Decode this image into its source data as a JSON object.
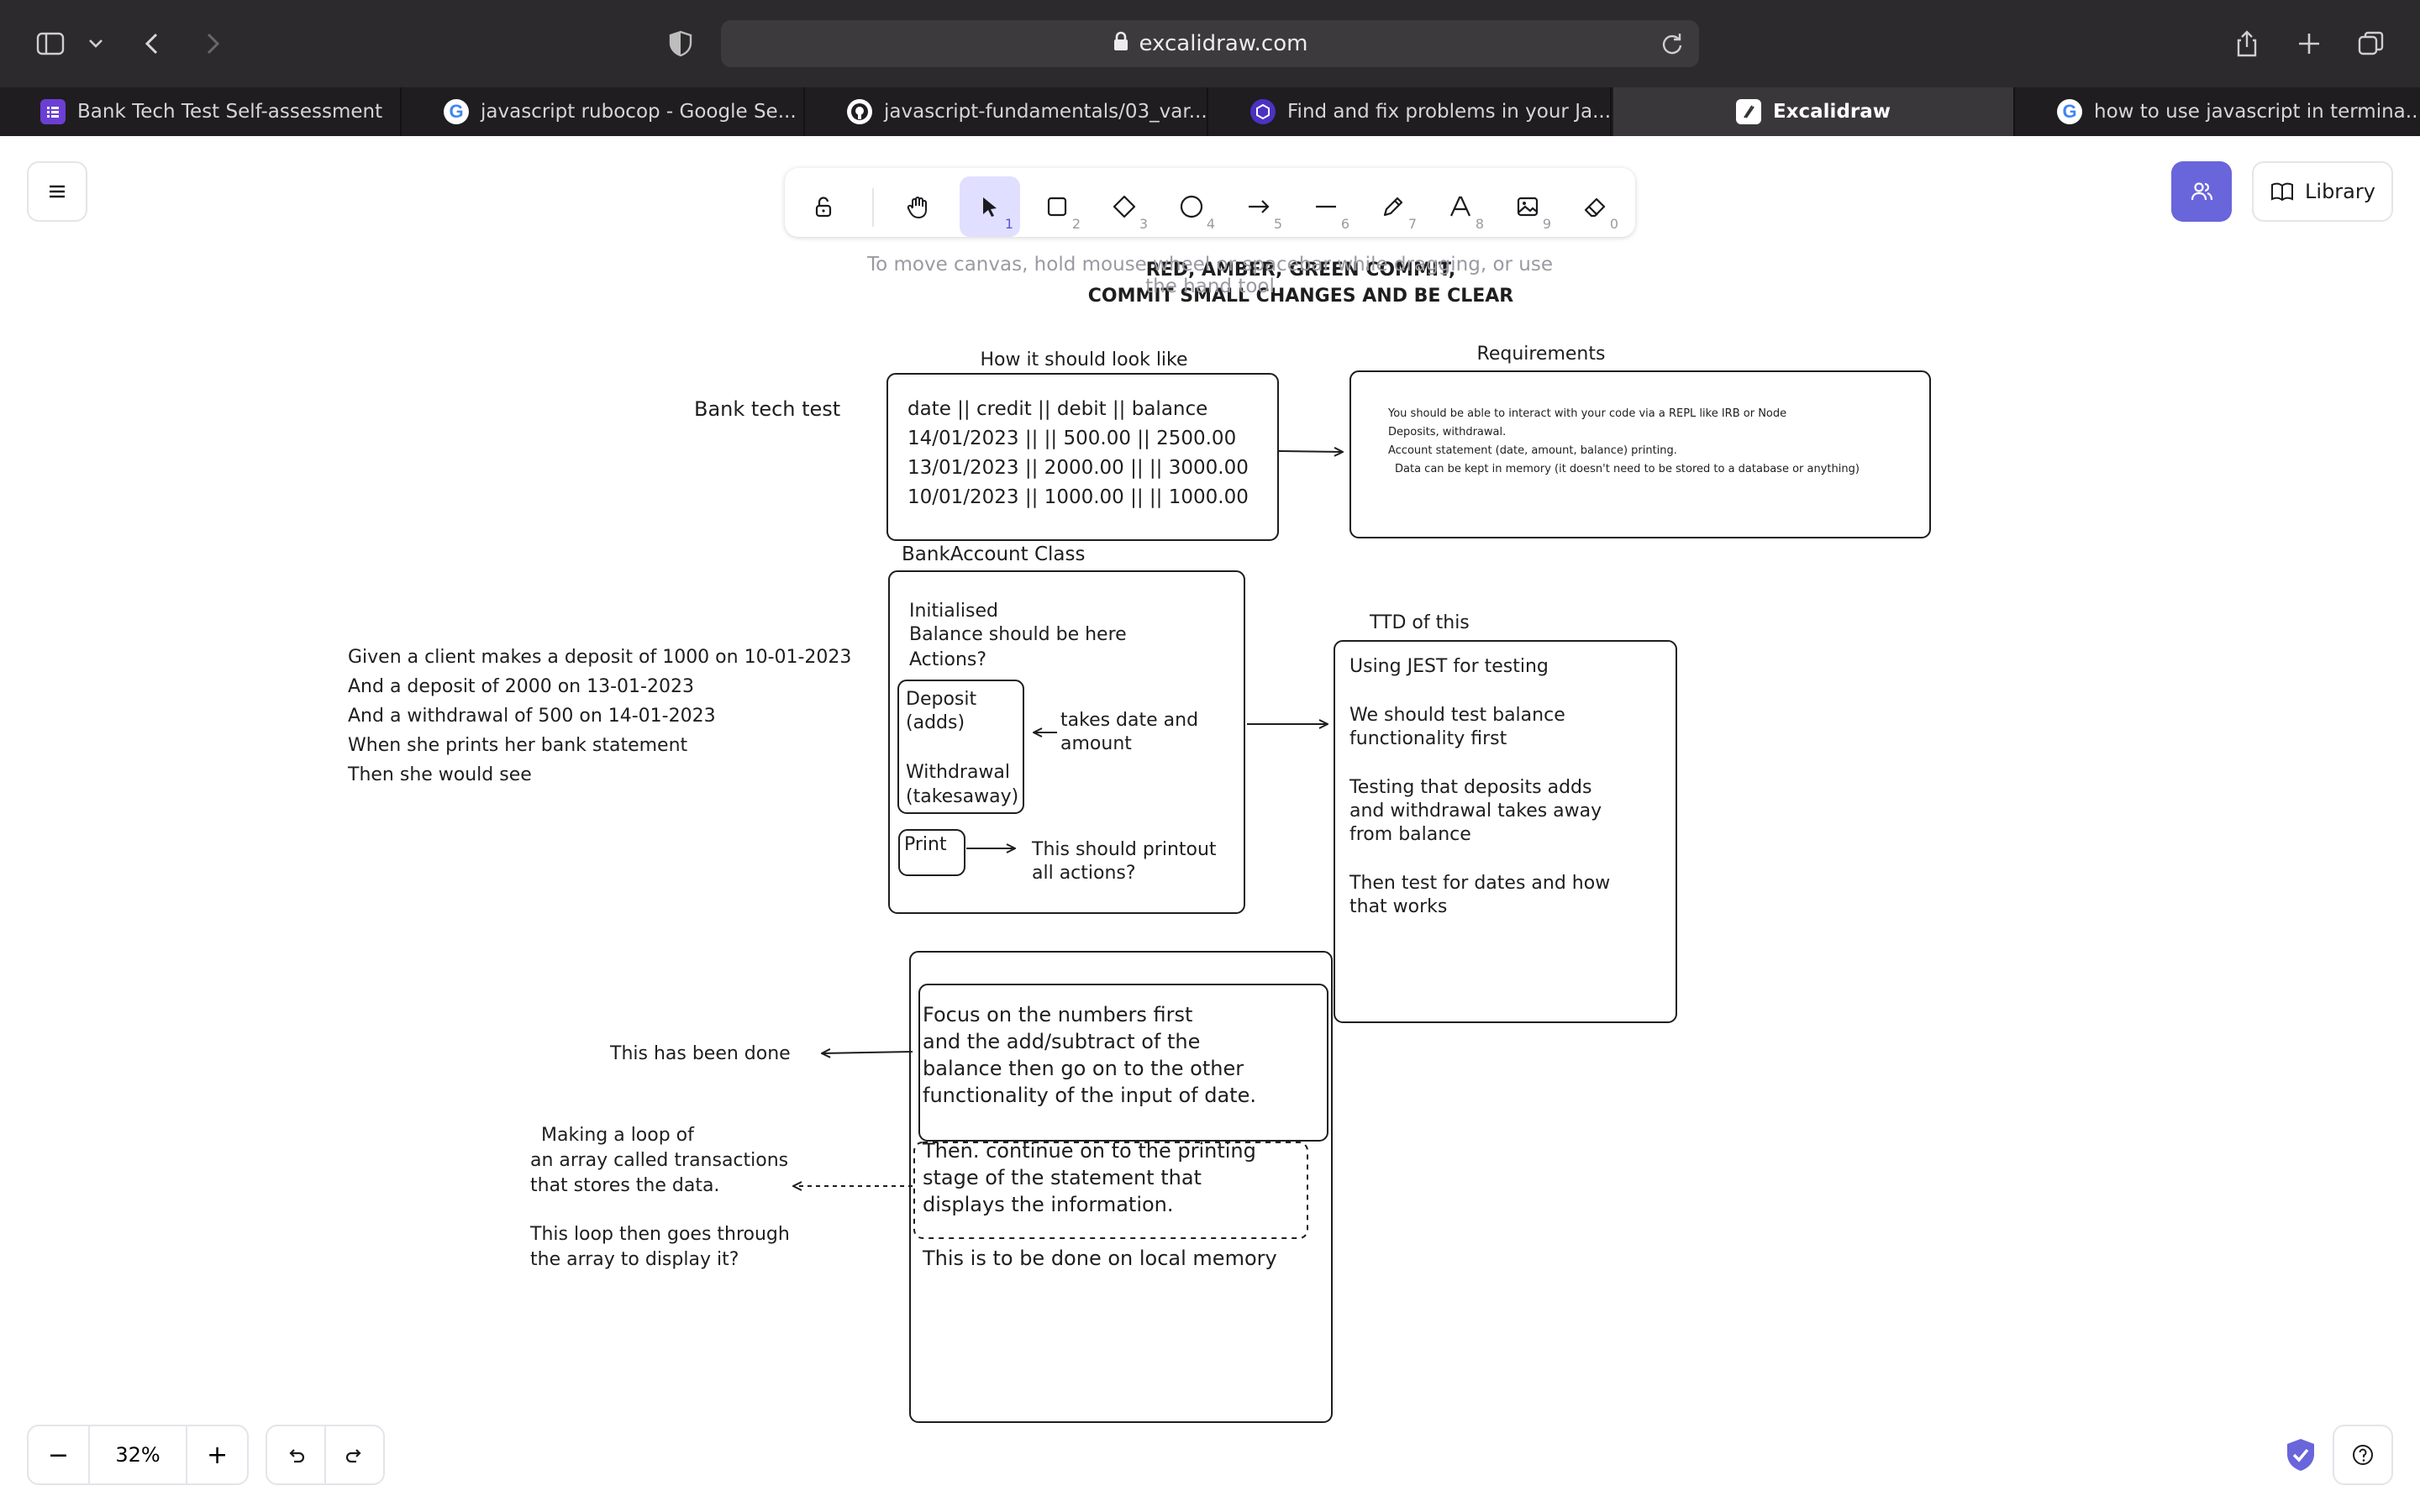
{
  "browser": {
    "url": "excalidraw.com",
    "tabs": [
      {
        "title": "Bank Tech Test Self-assessment",
        "icon": "form-icon",
        "color": "#6b3fd4"
      },
      {
        "title": "javascript rubocop - Google Se...",
        "icon": "google-icon",
        "color": "#4285f4"
      },
      {
        "title": "javascript-fundamentals/03_var...",
        "icon": "github-icon",
        "color": "#ffffff"
      },
      {
        "title": "Find and fix problems in your Ja...",
        "icon": "eslint-icon",
        "color": "#4b32c3"
      },
      {
        "title": "Excalidraw",
        "icon": "excalidraw-icon",
        "color": "#ffffff",
        "active": true
      },
      {
        "title": "how to use javascript in termina...",
        "icon": "google-icon",
        "color": "#4285f4"
      }
    ]
  },
  "toolbar": {
    "tools": [
      {
        "name": "lock",
        "key": ""
      },
      {
        "name": "hand",
        "key": ""
      },
      {
        "name": "selection",
        "key": "1",
        "active": true
      },
      {
        "name": "rectangle",
        "key": "2"
      },
      {
        "name": "diamond",
        "key": "3"
      },
      {
        "name": "ellipse",
        "key": "4"
      },
      {
        "name": "arrow",
        "key": "5"
      },
      {
        "name": "line",
        "key": "6"
      },
      {
        "name": "draw",
        "key": "7"
      },
      {
        "name": "text",
        "key": "8"
      },
      {
        "name": "image",
        "key": "9"
      },
      {
        "name": "eraser",
        "key": "0"
      }
    ],
    "hint": "To move canvas, hold mouse wheel or spacebar while dragging, or use the hand tool",
    "accent": "#6965db"
  },
  "library_label": "Library",
  "zoom": {
    "value": "32%",
    "minus": "−",
    "plus": "+"
  },
  "canvas_text": {
    "header_line1": "RED, AMBER, GREEN COMMIT,",
    "header_line2": "COMMIT SMALL CHANGES AND BE CLEAR",
    "how_title": "How it should look like",
    "bank_tech_test": "Bank tech test",
    "statement": [
      "date || credit || debit || balance",
      "14/01/2023 || || 500.00 || 2500.00",
      "13/01/2023 || 2000.00 || || 3000.00",
      "10/01/2023 || 1000.00 || || 1000.00"
    ],
    "requirements_title": "Requirements",
    "requirements": [
      "You should be able to interact with your code via a REPL like IRB or Node",
      "Deposits, withdrawal.",
      "Account statement (date, amount, balance) printing.",
      "Data can be kept in memory (it doesn't need to be stored to a database or anything)"
    ],
    "bankaccount_title": "BankAccount Class",
    "initialised": [
      "Initialised",
      "Balance should be here",
      "Actions?"
    ],
    "deposit": [
      "Deposit",
      "(adds)"
    ],
    "withdrawal": [
      "Withdrawal",
      "(takesaway)"
    ],
    "takes_date": [
      "takes date and",
      "amount"
    ],
    "print": "Print",
    "print_note": [
      "This should printout",
      "all actions?"
    ],
    "scenario": [
      "Given a client makes a deposit of 1000 on 10-01-2023",
      "And a deposit of 2000 on 13-01-2023",
      "And a withdrawal of 500 on 14-01-2023",
      "When she prints her bank statement",
      "Then she would see"
    ],
    "ttd_title": "TTD of this",
    "ttd": [
      "Using JEST for testing",
      "",
      "We should test balance",
      "functionality first",
      "",
      "Testing that deposits adds",
      "and withdrawal takes away",
      "from balance",
      "",
      "Then test for dates and how",
      "that works"
    ],
    "focus": [
      "Focus on the numbers first",
      "and the add/subtract of the",
      "balance then go on to the other",
      "functionality of the input of date."
    ],
    "done": "This has been done",
    "then_continue": [
      "Then. continue on to the printing",
      "stage of the statement that",
      "displays the information."
    ],
    "loop": [
      "Making a loop of",
      "an array called transactions",
      "that stores the data.",
      "",
      "This loop then goes through",
      "the array to display it?"
    ],
    "local_memory": "This is to be done on local memory"
  }
}
